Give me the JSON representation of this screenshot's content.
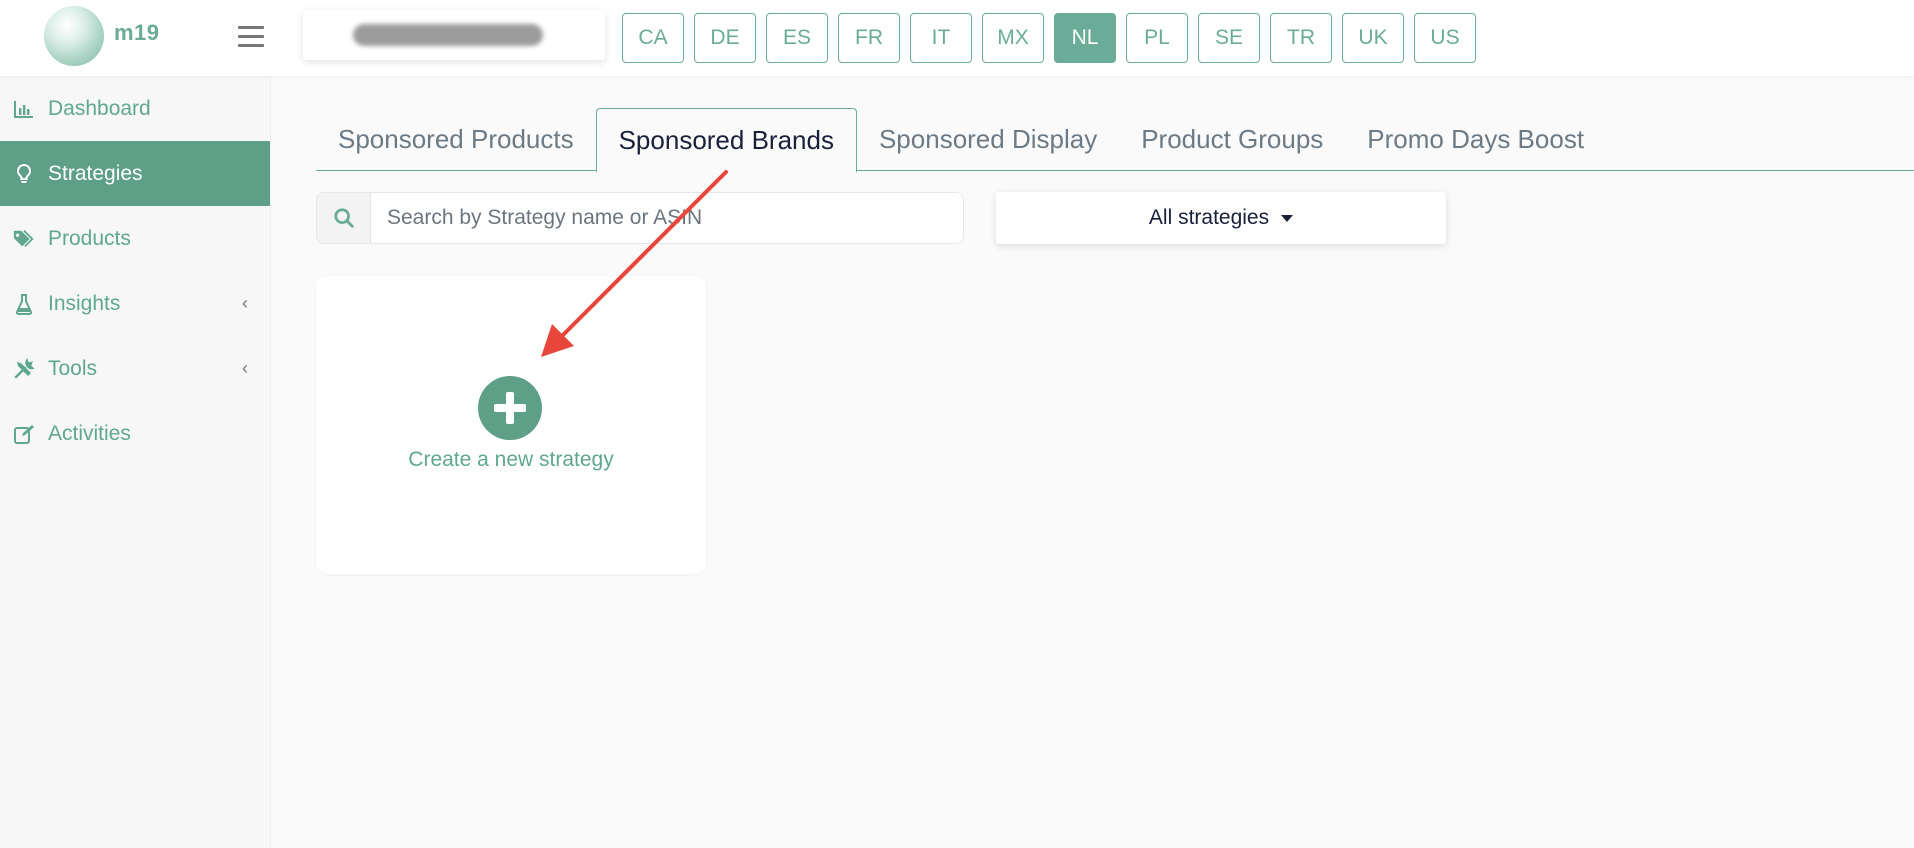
{
  "app": {
    "logo_text": "m19"
  },
  "countries": [
    "CA",
    "DE",
    "ES",
    "FR",
    "IT",
    "MX",
    "NL",
    "PL",
    "SE",
    "TR",
    "UK",
    "US"
  ],
  "active_country": "NL",
  "sidebar": {
    "items": [
      {
        "label": "Dashboard",
        "icon": "bar-chart-icon"
      },
      {
        "label": "Strategies",
        "icon": "lightbulb-icon",
        "active": true
      },
      {
        "label": "Products",
        "icon": "tags-icon"
      },
      {
        "label": "Insights",
        "icon": "flask-icon",
        "has_submenu": true
      },
      {
        "label": "Tools",
        "icon": "tools-icon",
        "has_submenu": true
      },
      {
        "label": "Activities",
        "icon": "edit-icon"
      }
    ],
    "submenu_caret": "‹"
  },
  "tabs": [
    "Sponsored Products",
    "Sponsored Brands",
    "Sponsored Display",
    "Product Groups",
    "Promo Days Boost"
  ],
  "active_tab": "Sponsored Brands",
  "search": {
    "placeholder": "Search by Strategy name or ASIN",
    "value": ""
  },
  "filter": {
    "selected": "All strategies"
  },
  "create_card": {
    "label": "Create a new strategy",
    "icon": "plus-circle-icon"
  },
  "colors": {
    "accent": "#6aac97",
    "accent_dark": "#5e9f88",
    "annotation_arrow": "#e8463a"
  }
}
